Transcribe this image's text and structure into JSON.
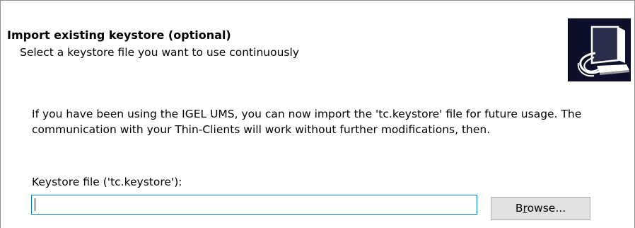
{
  "header": {
    "title": "Import existing keystore (optional)",
    "subtitle": "Select a keystore file you want to use continuously",
    "icon": "computer-with-cable-icon"
  },
  "main": {
    "description": "If you have been using the IGEL UMS, you can now import the 'tc.keystore' file for future usage. The communication with your Thin-Clients will work without further modifications, then.",
    "keystore_label": "Keystore file ('tc.keystore'):",
    "keystore_value": "",
    "browse_button": {
      "label_before": "B",
      "mnemonic": "r",
      "label_after": "owse..."
    }
  },
  "colors": {
    "input_focus_border": "#0078d7",
    "button_bg": "#e1e1e1",
    "button_border": "#adadad",
    "graphic_bg": "#0d0f2b"
  }
}
